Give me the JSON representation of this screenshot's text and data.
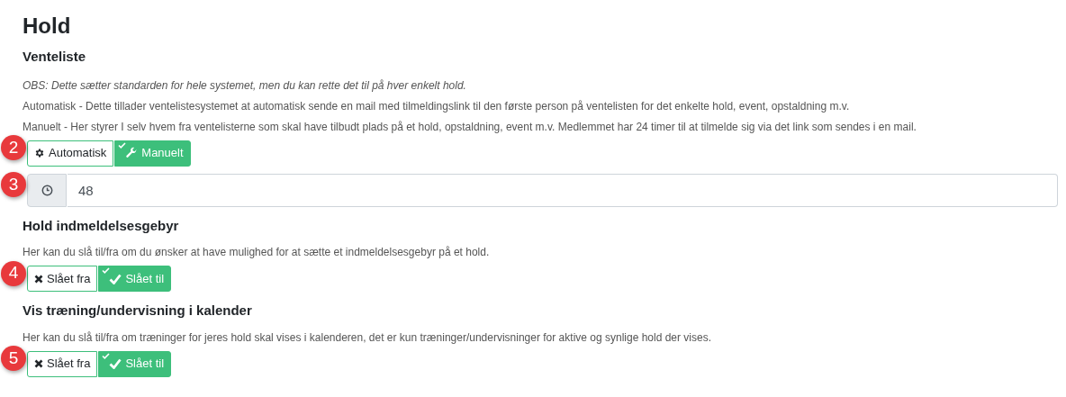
{
  "title": "Hold",
  "sections": [
    {
      "heading": "Venteliste",
      "paragraphs": [
        {
          "text": "OBS: Dette sætter standarden for hele systemet, men du kan rette det til på hver enkelt hold.",
          "italic": true
        },
        {
          "text": "Automatisk - Dette tillader ventelistesystemet at automatisk sende en mail med tilmeldingslink til den første person på ventelisten for det enkelte hold, event, opstaldning m.v.",
          "italic": false
        },
        {
          "text": "Manuelt - Her styrer I selv hvem fra ventelisterne som skal have tilbudt plads på et hold, opstaldning, event m.v. Medlemmet har 24 timer til at tilmelde sig via det link som sendes i en mail.",
          "italic": false
        }
      ],
      "controls": [
        {
          "kind": "toggle",
          "badge": "2",
          "options": [
            {
              "label": "Automatisk",
              "kind": "automatic",
              "selected": false
            },
            {
              "label": "Manuelt",
              "kind": "manual",
              "selected": true
            }
          ]
        },
        {
          "kind": "input",
          "badge": "3",
          "value": "48"
        }
      ]
    },
    {
      "heading": "Hold indmeldelsesgebyr",
      "paragraphs": [
        {
          "text": "Her kan du slå til/fra om du ønsker at have mulighed for at sætte et indmeldelsesgebyr på et hold.",
          "italic": false
        }
      ],
      "controls": [
        {
          "kind": "toggle",
          "badge": "4",
          "options": [
            {
              "label": "Slået fra",
              "kind": "off",
              "selected": false
            },
            {
              "label": "Slået til",
              "kind": "on",
              "selected": true
            }
          ]
        }
      ]
    },
    {
      "heading": "Vis træning/undervisning i kalender",
      "paragraphs": [
        {
          "text": "Her kan du slå til/fra om træninger for jeres hold skal vises i kalenderen, det er kun træninger/undervisninger for aktive og synlige hold der vises.",
          "italic": false
        }
      ],
      "controls": [
        {
          "kind": "toggle",
          "badge": "5",
          "options": [
            {
              "label": "Slået fra",
              "kind": "off",
              "selected": false
            },
            {
              "label": "Slået til",
              "kind": "on",
              "selected": true
            }
          ]
        }
      ]
    }
  ]
}
